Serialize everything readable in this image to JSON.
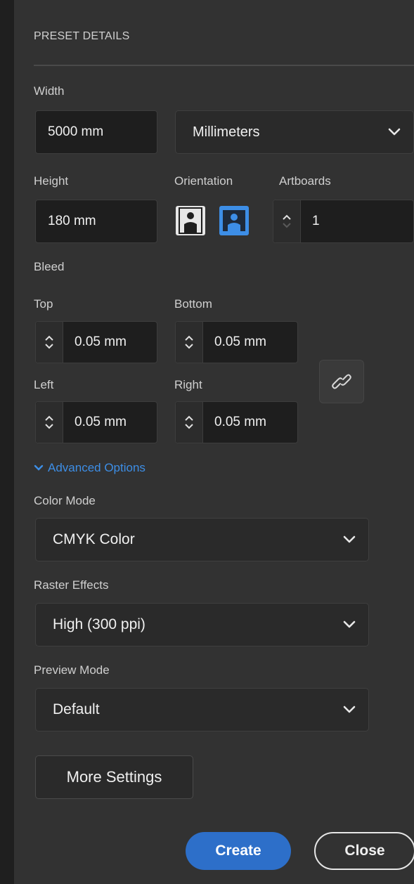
{
  "section_title": "PRESET DETAILS",
  "width": {
    "label": "Width",
    "value": "5000 mm",
    "unit": "Millimeters"
  },
  "height": {
    "label": "Height",
    "value": "180 mm"
  },
  "orientation": {
    "label": "Orientation",
    "selected": "landscape"
  },
  "artboards": {
    "label": "Artboards",
    "value": "1"
  },
  "bleed": {
    "label": "Bleed",
    "top": {
      "label": "Top",
      "value": "0.05 mm"
    },
    "bottom": {
      "label": "Bottom",
      "value": "0.05 mm"
    },
    "left": {
      "label": "Left",
      "value": "0.05 mm"
    },
    "right": {
      "label": "Right",
      "value": "0.05 mm"
    }
  },
  "advanced": {
    "label": "Advanced Options"
  },
  "color_mode": {
    "label": "Color Mode",
    "value": "CMYK Color"
  },
  "raster_effects": {
    "label": "Raster Effects",
    "value": "High (300 ppi)"
  },
  "preview_mode": {
    "label": "Preview Mode",
    "value": "Default"
  },
  "buttons": {
    "more_settings": "More Settings",
    "create": "Create",
    "close": "Close"
  },
  "colors": {
    "accent": "#2d6fc9",
    "link": "#3d8ee6",
    "panel": "#323232",
    "field": "#1e1e1e"
  }
}
